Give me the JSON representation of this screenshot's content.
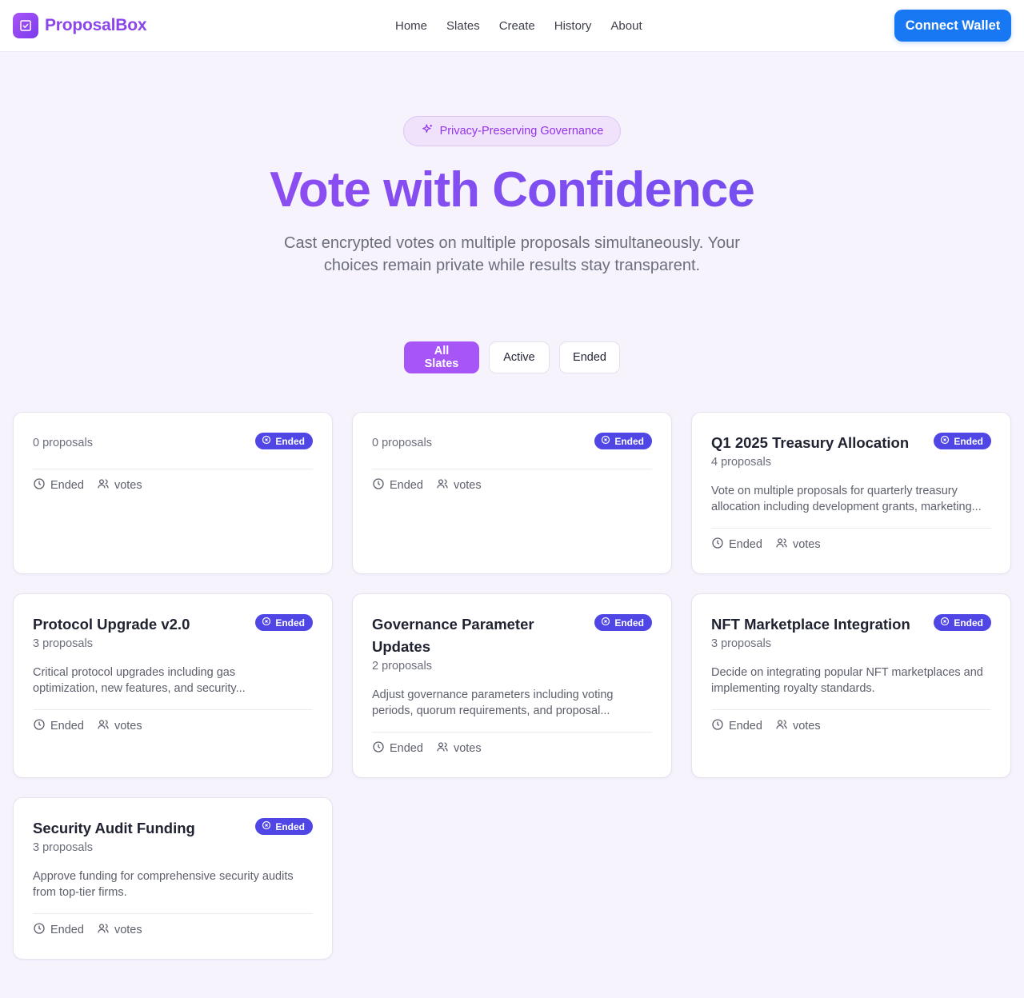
{
  "header": {
    "brand": "ProposalBox",
    "nav": [
      "Home",
      "Slates",
      "Create",
      "History",
      "About"
    ],
    "connect_label": "Connect Wallet"
  },
  "hero": {
    "badge": "Privacy-Preserving Governance",
    "title": "Vote with Confidence",
    "subtitle_line1": "Cast encrypted votes on multiple proposals simultaneously. Your",
    "subtitle_line2": "choices remain private while results stay transparent."
  },
  "filters": [
    "All Slates",
    "Active",
    "Ended"
  ],
  "cards": [
    {
      "title": "",
      "count": "0 proposals",
      "desc": "",
      "status": "Ended",
      "time": "Ended",
      "votes": "votes"
    },
    {
      "title": "",
      "count": "0 proposals",
      "desc": "",
      "status": "Ended",
      "time": "Ended",
      "votes": "votes"
    },
    {
      "title": "Q1 2025 Treasury Allocation",
      "count": "4 proposals",
      "desc_line1": "Vote on multiple proposals for quarterly treasury",
      "desc_line2": "allocation including development grants, marketing...",
      "status": "Ended",
      "time": "Ended",
      "votes": "votes"
    },
    {
      "title": "Protocol Upgrade v2.0",
      "count": "3 proposals",
      "desc_line1": "Critical protocol upgrades including gas",
      "desc_line2": "optimization, new features, and security...",
      "status": "Ended",
      "time": "Ended",
      "votes": "votes"
    },
    {
      "title_line1": "Governance Parameter",
      "title_line2": "Updates",
      "count": "2 proposals",
      "desc_line1": "Adjust governance parameters including voting",
      "desc_line2": "periods, quorum requirements, and proposal...",
      "status": "Ended",
      "time": "Ended",
      "votes": "votes"
    },
    {
      "title": "NFT Marketplace Integration",
      "count": "3 proposals",
      "desc_line1": "Decide on integrating popular NFT marketplaces and",
      "desc_line2": "implementing royalty standards.",
      "status": "Ended",
      "time": "Ended",
      "votes": "votes"
    },
    {
      "title": "Security Audit Funding",
      "count": "3 proposals",
      "desc_line1": "Approve funding for comprehensive security audits",
      "desc_line2": "from top-tier firms.",
      "status": "Ended",
      "time": "Ended",
      "votes": "votes"
    }
  ],
  "colors": {
    "brand": "#8b45e8",
    "connect": "#1877f2",
    "filter_active": "#a855f7",
    "status_ended": "#4f46e5",
    "background": "#f6f3fd"
  },
  "icons": {
    "logo": "ballot-box-icon",
    "badge": "sparkles-icon",
    "status": "x-circle-icon",
    "time": "clock-icon",
    "votes": "users-icon"
  }
}
